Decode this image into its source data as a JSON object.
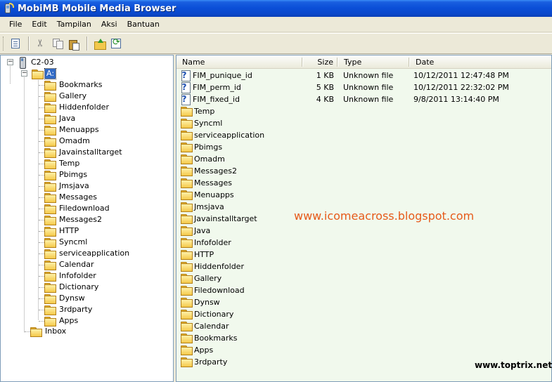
{
  "window": {
    "title": "MobiMB Mobile Media Browser"
  },
  "menu": [
    "File",
    "Edit",
    "Tampilan",
    "Aksi",
    "Bantuan"
  ],
  "toolbar": {
    "icons": [
      "properties-icon",
      "cut-icon",
      "copy-icon",
      "paste-icon",
      "up-folder-icon",
      "refresh-icon"
    ]
  },
  "tree": {
    "device": "C2-03",
    "drive": "A:",
    "folders": [
      "Bookmarks",
      "Gallery",
      "Hiddenfolder",
      "Java",
      "Menuapps",
      "Omadm",
      "Javainstalltarget",
      "Temp",
      "Pbimgs",
      "Jmsjava",
      "Messages",
      "Filedownload",
      "Messages2",
      "HTTP",
      "Syncml",
      "serviceapplication",
      "Calendar",
      "Infofolder",
      "Dictionary",
      "Dynsw",
      "3rdparty",
      "Apps"
    ],
    "inbox": "Inbox"
  },
  "list": {
    "columns": [
      "Name",
      "Size",
      "Type",
      "Date"
    ],
    "files": [
      {
        "name": "FIM_punique_id",
        "size": "1 KB",
        "type": "Unknown file",
        "date": "10/12/2011 12:47:48 PM"
      },
      {
        "name": "FIM_perm_id",
        "size": "5 KB",
        "type": "Unknown file",
        "date": "10/12/2011 22:32:02 PM"
      },
      {
        "name": "FIM_fixed_id",
        "size": "4 KB",
        "type": "Unknown file",
        "date": "9/8/2011 13:14:40 PM"
      }
    ],
    "folders": [
      "Temp",
      "Syncml",
      "serviceapplication",
      "Pbimgs",
      "Omadm",
      "Messages2",
      "Messages",
      "Menuapps",
      "Jmsjava",
      "Javainstalltarget",
      "Java",
      "Infofolder",
      "HTTP",
      "Hiddenfolder",
      "Gallery",
      "Filedownload",
      "Dynsw",
      "Dictionary",
      "Calendar",
      "Bookmarks",
      "Apps",
      "3rdparty"
    ]
  },
  "watermarks": {
    "blog": "www.icomeacross.blogspot.com",
    "site": "www.toptrix.net"
  },
  "colors": {
    "titlebar": "#0a48cc",
    "list_bg": "#f1f9ed",
    "selection": "#316ac5",
    "watermark": "#e65a1a"
  }
}
